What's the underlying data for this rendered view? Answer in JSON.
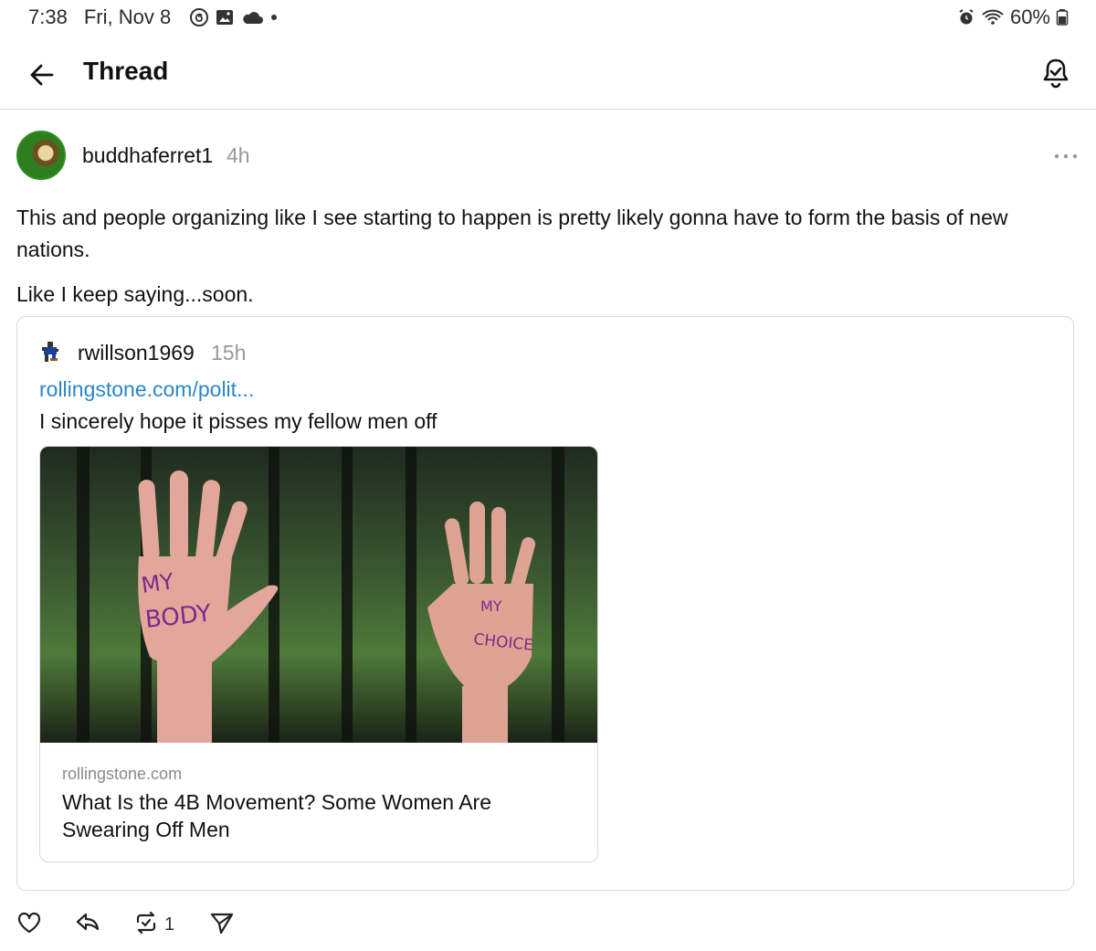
{
  "status_bar": {
    "time": "7:38",
    "date": "Fri, Nov 8",
    "battery": "60%"
  },
  "app_bar": {
    "title": "Thread"
  },
  "post": {
    "author": "buddhaferret1",
    "time": "4h",
    "paragraphs": [
      "This and people organizing like I see starting to happen is pretty likely gonna have to form the basis of new nations.",
      "Like I keep saying...soon."
    ]
  },
  "quoted_post": {
    "author": "rwillson1969",
    "time": "15h",
    "link": "rollingstone.com/polit...",
    "text": "I sincerely hope it pisses my fellow men off",
    "card": {
      "image_text_left": "MY BODY",
      "image_text_right": "MY CHOICE",
      "domain": "rollingstone.com",
      "title": "What Is the 4B Movement? Some Women Are Swearing Off Men"
    }
  },
  "actions": {
    "repost_count": "1"
  },
  "icons": [
    "threads-icon",
    "gallery-icon",
    "cloud-icon",
    "alarm-icon",
    "wifi-icon",
    "battery-icon",
    "back-arrow-icon",
    "bell-check-icon",
    "more-icon",
    "heart-icon",
    "reply-icon",
    "repost-icon",
    "send-icon"
  ],
  "colors": {
    "link": "#2a86c8",
    "muted": "#999999",
    "border": "#d9d9d9"
  }
}
